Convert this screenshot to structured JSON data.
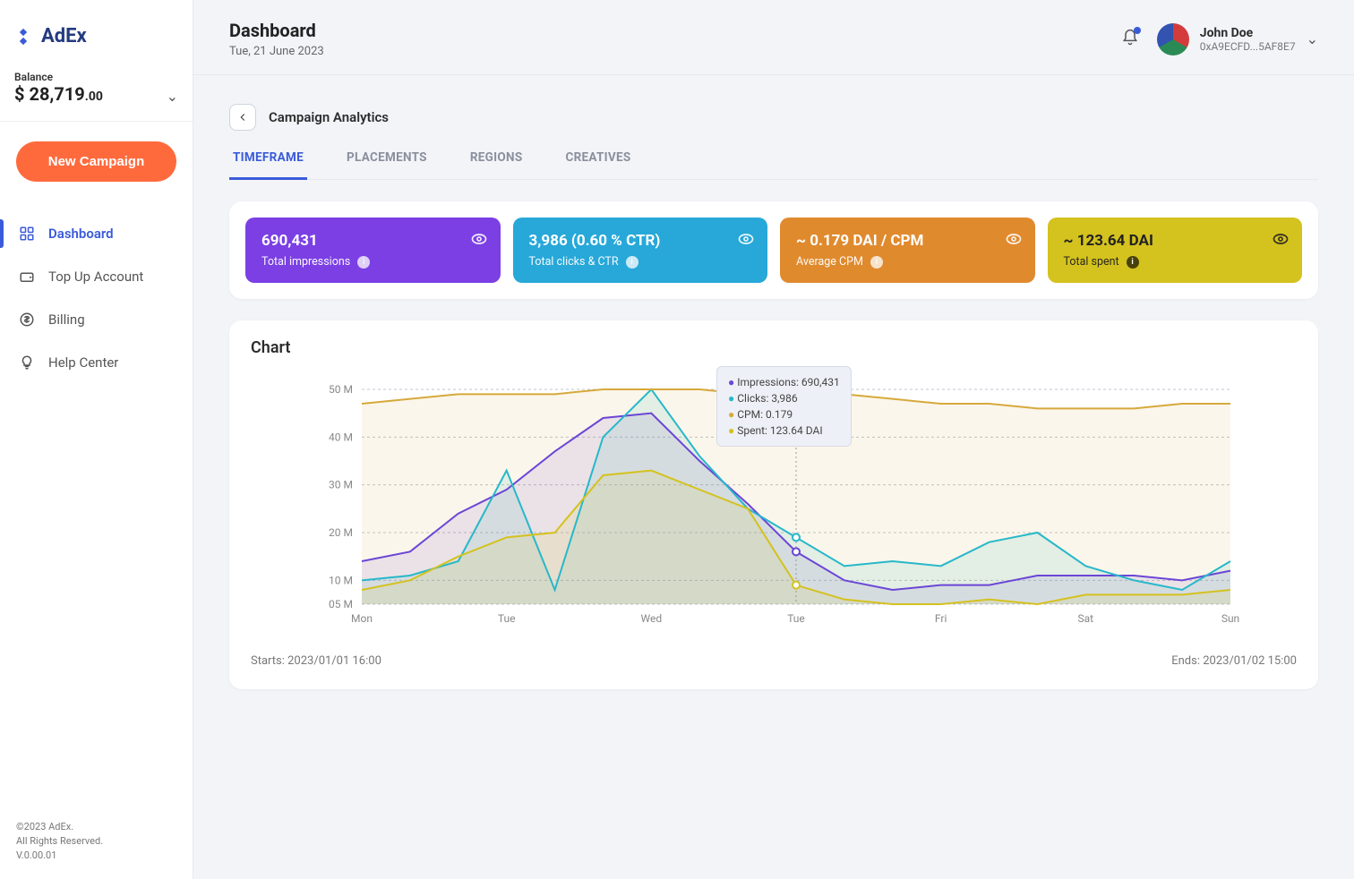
{
  "brand": {
    "name": "AdEx"
  },
  "balance": {
    "label": "Balance",
    "currency": "$",
    "amount": "28,719",
    "cents": ".00"
  },
  "sidebar": {
    "new_campaign": "New Campaign",
    "items": [
      {
        "label": "Dashboard",
        "icon": "grid-icon",
        "active": true
      },
      {
        "label": "Top Up Account",
        "icon": "wallet-icon",
        "active": false
      },
      {
        "label": "Billing",
        "icon": "dollar-icon",
        "active": false
      },
      {
        "label": "Help Center",
        "icon": "bulb-icon",
        "active": false
      }
    ]
  },
  "footer": {
    "copyright": "©2023 AdEx.",
    "rights": "All Rights Reserved.",
    "version": "V.0.00.01"
  },
  "header": {
    "title": "Dashboard",
    "date": "Tue, 21 June 2023",
    "user_name": "John Doe",
    "user_addr": "0xA9ECFD...5AF8E7"
  },
  "breadcrumb": {
    "label": "Campaign Analytics"
  },
  "tabs": [
    {
      "label": "TIMEFRAME",
      "active": true
    },
    {
      "label": "PLACEMENTS",
      "active": false
    },
    {
      "label": "REGIONS",
      "active": false
    },
    {
      "label": "CREATIVES",
      "active": false
    }
  ],
  "stats": [
    {
      "value": "690,431",
      "label": "Total impressions",
      "color": "purple"
    },
    {
      "value": "3,986 (0.60 % CTR)",
      "label": "Total clicks & CTR",
      "color": "blue"
    },
    {
      "value": "~ 0.179 DAI / CPM",
      "label": "Average CPM",
      "color": "orange"
    },
    {
      "value": "~ 123.64 DAI",
      "label": "Total spent",
      "color": "yellow"
    }
  ],
  "chart": {
    "title": "Chart",
    "starts": "Starts: 2023/01/01 16:00",
    "ends": "Ends: 2023/01/02 15:00",
    "tooltip": {
      "impressions": "Impressions: 690,431",
      "clicks": "Clicks: 3,986",
      "cpm": "CPM: 0.179",
      "spent": "Spent: 123.64 DAI"
    }
  },
  "chart_data": {
    "type": "line",
    "ylabel": "",
    "xlabel": "",
    "ylim": [
      5,
      50
    ],
    "y_ticks": [
      "50 M",
      "40 M",
      "30 M",
      "20 M",
      "10 M",
      "05 M"
    ],
    "x_ticks": [
      "Mon",
      "Tue",
      "Wed",
      "Tue",
      "Fri",
      "Sat",
      "Sun"
    ],
    "cursor_index": 9,
    "x_tick_indices": [
      0,
      3,
      6,
      9,
      12,
      15,
      18
    ],
    "series": [
      {
        "name": "Impressions",
        "color": "#6b46d6",
        "values": [
          14,
          16,
          24,
          29,
          37,
          44,
          45,
          35,
          26,
          16,
          10,
          8,
          9,
          9,
          11,
          11,
          11,
          10,
          12
        ]
      },
      {
        "name": "Clicks",
        "color": "#27b8c9",
        "values": [
          10,
          11,
          14,
          33,
          8,
          40,
          50,
          36,
          25,
          19,
          13,
          14,
          13,
          18,
          20,
          13,
          10,
          8,
          14
        ]
      },
      {
        "name": "CPM",
        "color": "#d6a93b",
        "values": [
          47,
          48,
          49,
          49,
          49,
          50,
          50,
          50,
          49,
          49,
          49,
          48,
          47,
          47,
          46,
          46,
          46,
          47,
          47
        ]
      },
      {
        "name": "Spent",
        "color": "#d4c21e",
        "values": [
          8,
          10,
          15,
          19,
          20,
          32,
          33,
          29,
          25,
          9,
          6,
          5,
          5,
          6,
          5,
          7,
          7,
          7,
          8
        ]
      }
    ]
  }
}
